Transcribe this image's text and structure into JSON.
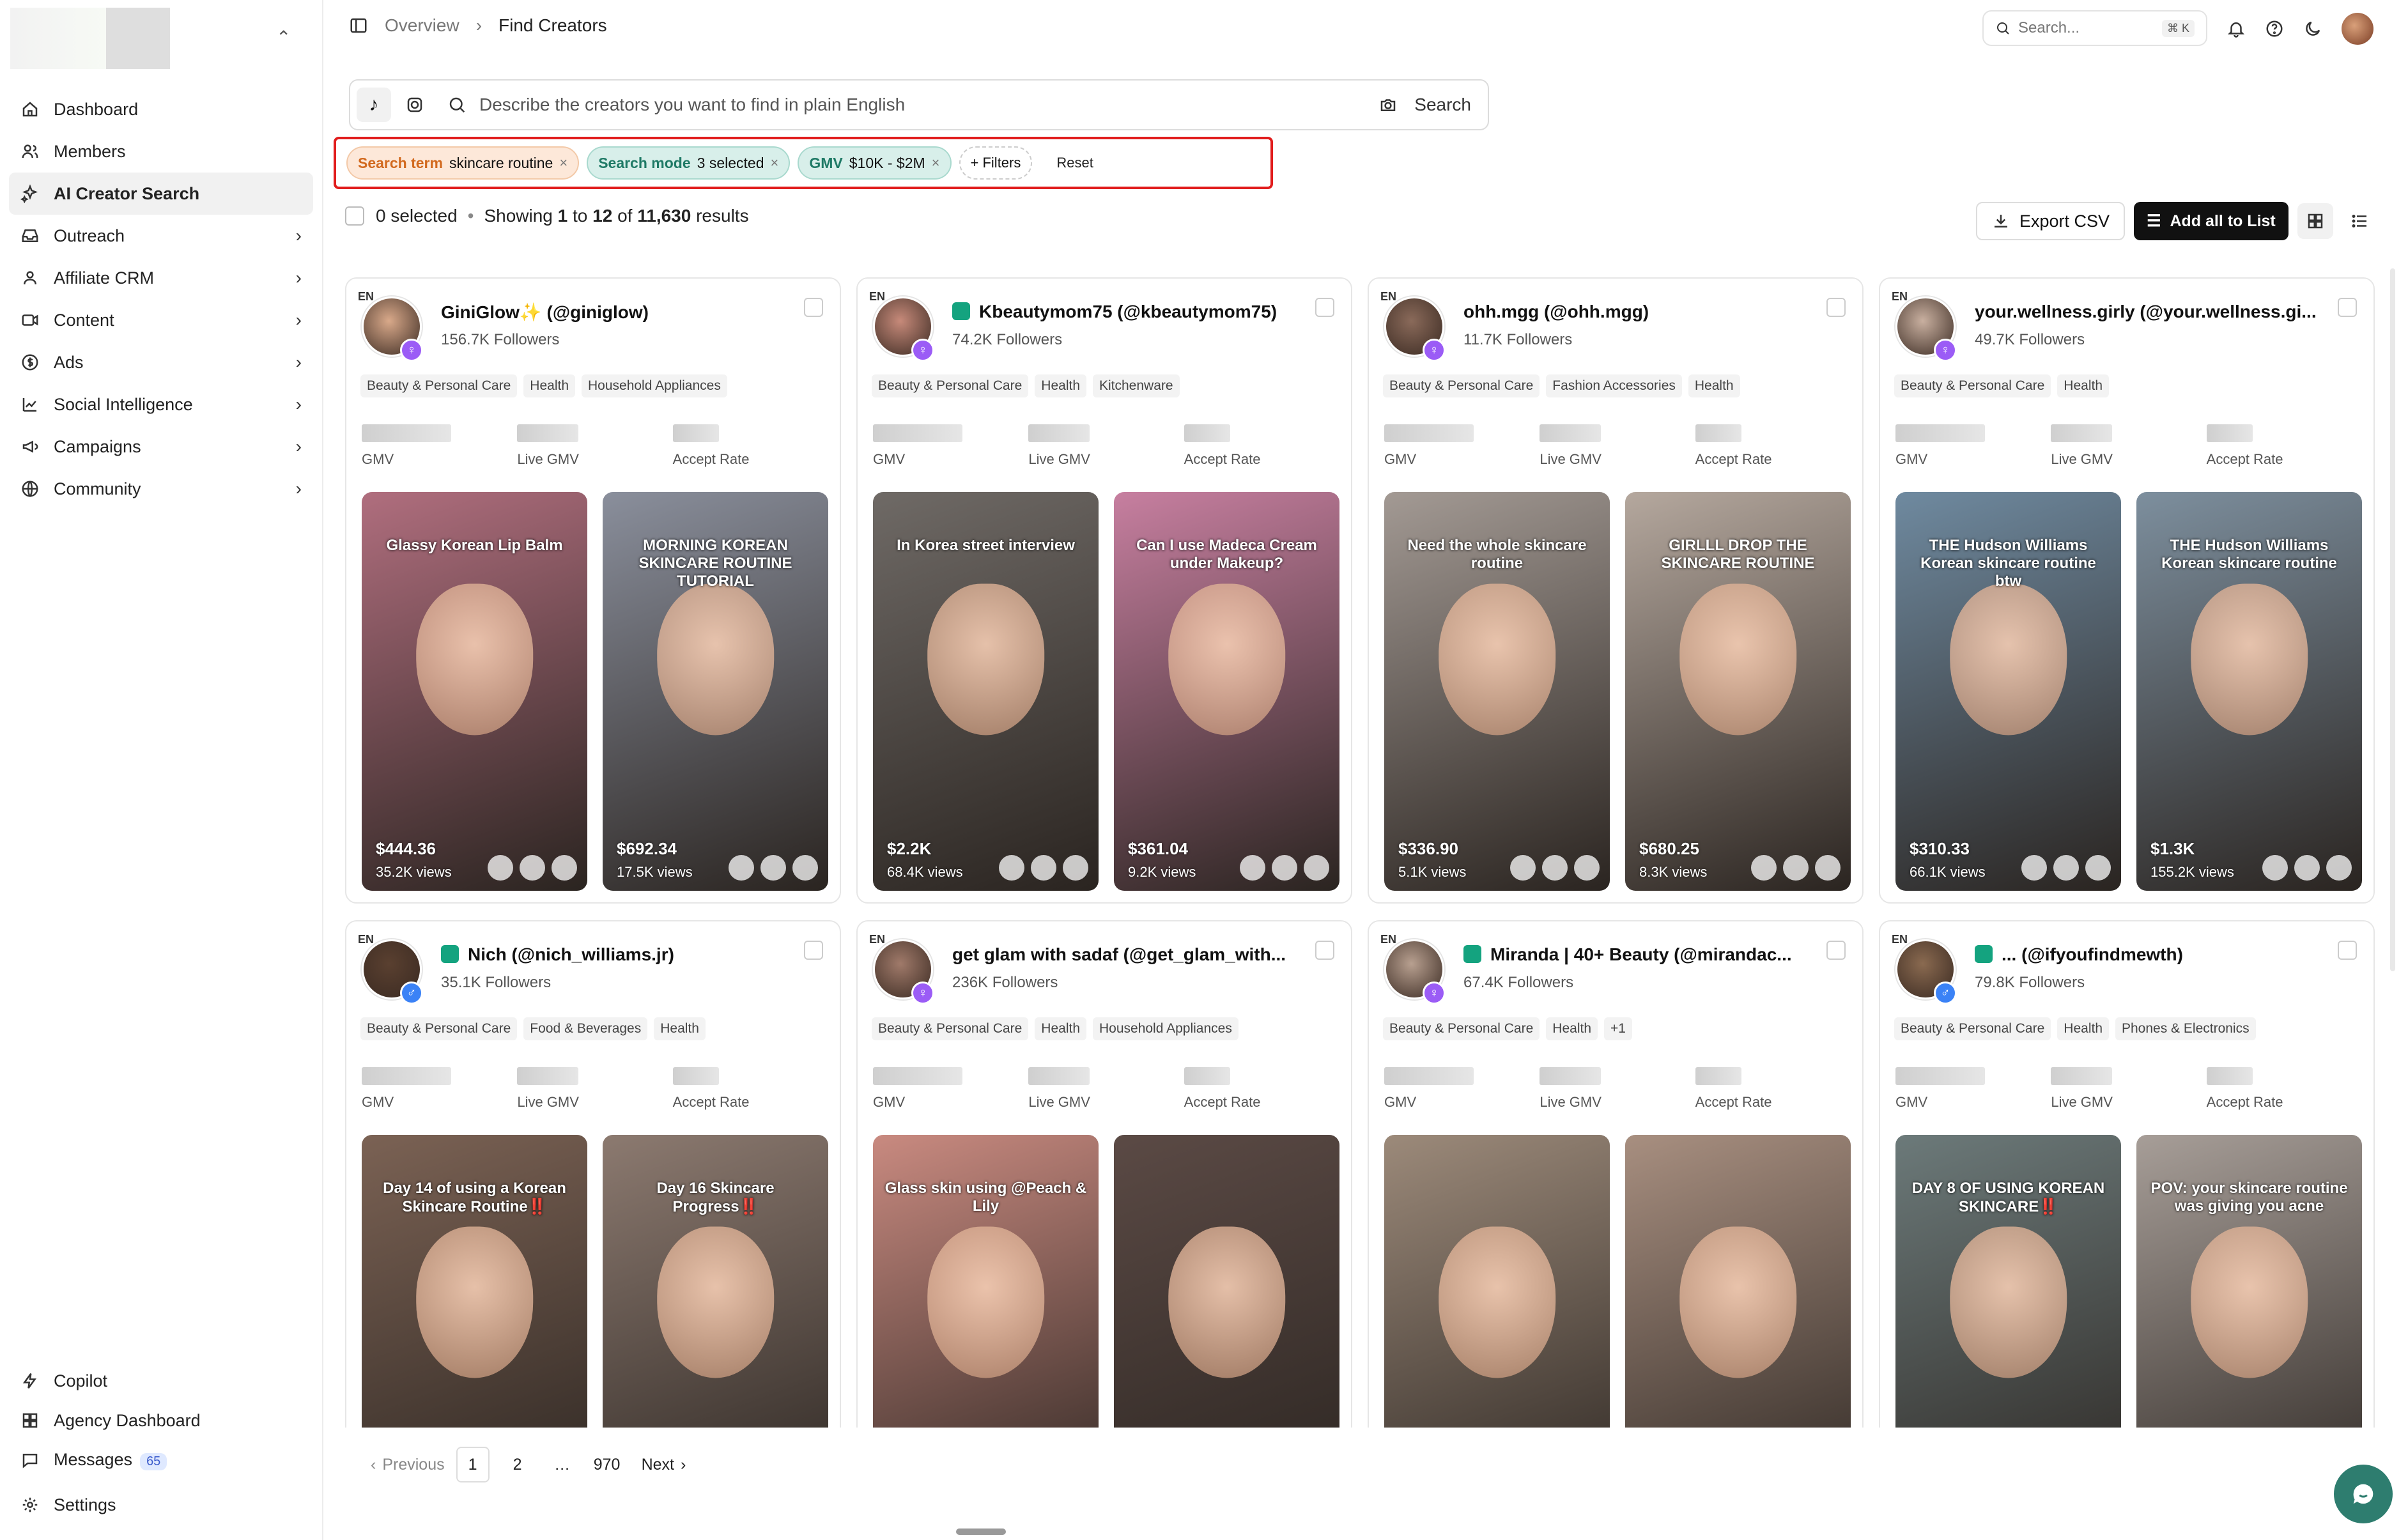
{
  "sidebar": {
    "items": [
      {
        "label": "Dashboard",
        "icon": "home-icon",
        "chevron": false,
        "active": false
      },
      {
        "label": "Members",
        "icon": "users-icon",
        "chevron": false,
        "active": false
      },
      {
        "label": "AI Creator Search",
        "icon": "sparkles-icon",
        "chevron": false,
        "active": true
      },
      {
        "label": "Outreach",
        "icon": "inbox-icon",
        "chevron": true,
        "active": false
      },
      {
        "label": "Affiliate CRM",
        "icon": "contacts-icon",
        "chevron": true,
        "active": false
      },
      {
        "label": "Content",
        "icon": "video-icon",
        "chevron": true,
        "active": false
      },
      {
        "label": "Ads",
        "icon": "dollar-icon",
        "chevron": true,
        "active": false
      },
      {
        "label": "Social Intelligence",
        "icon": "chart-icon",
        "chevron": true,
        "active": false
      },
      {
        "label": "Campaigns",
        "icon": "megaphone-icon",
        "chevron": true,
        "active": false
      },
      {
        "label": "Community",
        "icon": "globe-icon",
        "chevron": true,
        "active": false
      }
    ],
    "bottom": [
      {
        "label": "Copilot",
        "icon": "bolt-icon"
      },
      {
        "label": "Agency Dashboard",
        "icon": "grid-icon"
      },
      {
        "label": "Messages",
        "icon": "message-icon",
        "badge": "65"
      },
      {
        "label": "Settings",
        "icon": "gear-icon"
      }
    ]
  },
  "header": {
    "breadcrumb": [
      "Overview",
      "Find Creators"
    ],
    "search_placeholder": "Search...",
    "search_shortcut": "⌘ K"
  },
  "search": {
    "placeholder": "Describe the creators you want to find in plain English",
    "button": "Search"
  },
  "filters": {
    "chips": [
      {
        "key": "Search term",
        "value": "skincare routine",
        "style": "orange"
      },
      {
        "key": "Search mode",
        "value": "3 selected",
        "style": "green"
      },
      {
        "key": "GMV",
        "value": "$10K - $2M",
        "style": "green"
      }
    ],
    "add_filters": "+ Filters",
    "reset": "Reset"
  },
  "results": {
    "selected": "0 selected",
    "showing_prefix": "Showing",
    "from": "1",
    "to_word": "to",
    "to": "12",
    "of_word": "of",
    "total": "11,630",
    "suffix": "results",
    "export": "Export CSV",
    "add_all": "Add all to List"
  },
  "metric_labels": [
    "GMV",
    "Live GMV",
    "Accept Rate"
  ],
  "creators": [
    {
      "name": "GiniGlow✨ (@giniglow)",
      "followers": "156.7K Followers",
      "gender": "f",
      "cats": [
        "Beauty & Personal Care",
        "Health",
        "Household Appliances"
      ],
      "videos": [
        {
          "gmv": "$444.36",
          "views": "35.2K views",
          "caption": "Glassy Korean Lip Balm",
          "bg": "#b06e7e"
        },
        {
          "gmv": "$692.34",
          "views": "17.5K views",
          "caption": "MORNING KOREAN SKINCARE ROUTINE TUTORIAL",
          "bg": "#8a8f9c"
        }
      ]
    },
    {
      "name": "Kbeautymom75 (@kbeautymom75)",
      "followers": "74.2K Followers",
      "gender": "f",
      "tag": true,
      "cats": [
        "Beauty & Personal Care",
        "Health",
        "Kitchenware"
      ],
      "videos": [
        {
          "gmv": "$2.2K",
          "views": "68.4K views",
          "caption": "In Korea street interview",
          "bg": "#6f6a66"
        },
        {
          "gmv": "$361.04",
          "views": "9.2K views",
          "caption": "Can I use Madeca Cream under Makeup?",
          "bg": "#c77fa0"
        }
      ]
    },
    {
      "name": "ohh.mgg (@ohh.mgg)",
      "followers": "11.7K Followers",
      "gender": "f",
      "cats": [
        "Beauty & Personal Care",
        "Fashion Accessories",
        "Health"
      ],
      "videos": [
        {
          "gmv": "$336.90",
          "views": "5.1K views",
          "caption": "Need the whole skincare routine",
          "bg": "#a39a94"
        },
        {
          "gmv": "$680.25",
          "views": "8.3K views",
          "caption": "GIRLLL DROP THE SKINCARE ROUTINE",
          "bg": "#b5a89e"
        }
      ]
    },
    {
      "name": "your.wellness.girly (@your.wellness.gi...",
      "followers": "49.7K Followers",
      "gender": "f",
      "cats": [
        "Beauty & Personal Care",
        "Health"
      ],
      "videos": [
        {
          "gmv": "$310.33",
          "views": "66.1K views",
          "caption": "THE Hudson Williams Korean skincare routine btw",
          "bg": "#6f8aa0"
        },
        {
          "gmv": "$1.3K",
          "views": "155.2K views",
          "caption": "THE Hudson Williams Korean skincare routine",
          "bg": "#7d8f9e"
        }
      ]
    },
    {
      "name": "Nich (@nich_williams.jr)",
      "followers": "35.1K Followers",
      "gender": "m",
      "tag": true,
      "cats": [
        "Beauty & Personal Care",
        "Food & Beverages",
        "Health"
      ],
      "videos": [
        {
          "gmv": "",
          "views": "",
          "caption": "Day 14 of using a Korean Skincare Routine‼️",
          "bg": "#7b6254"
        },
        {
          "gmv": "",
          "views": "",
          "caption": "Day 16 Skincare Progress‼️",
          "bg": "#8c7a70"
        }
      ]
    },
    {
      "name": "get glam with sadaf (@get_glam_with...",
      "followers": "236K Followers",
      "gender": "f",
      "cats": [
        "Beauty & Personal Care",
        "Health",
        "Household Appliances"
      ],
      "videos": [
        {
          "gmv": "",
          "views": "",
          "caption": "Glass skin using @Peach & Lily",
          "bg": "#c98a80"
        },
        {
          "gmv": "",
          "views": "",
          "caption": "",
          "bg": "#5b4a45"
        }
      ]
    },
    {
      "name": "Miranda | 40+ Beauty (@mirandac...",
      "followers": "67.4K Followers",
      "gender": "f",
      "tag": true,
      "cats": [
        "Beauty & Personal Care",
        "Health",
        "+1"
      ],
      "videos": [
        {
          "gmv": "",
          "views": "",
          "caption": "",
          "bg": "#9c8a7a"
        },
        {
          "gmv": "",
          "views": "",
          "caption": "",
          "bg": "#a88f80"
        }
      ]
    },
    {
      "name": "... (@ifyoufindmewth)",
      "followers": "79.8K Followers",
      "gender": "m",
      "tag": true,
      "cats": [
        "Beauty & Personal Care",
        "Health",
        "Phones & Electronics"
      ],
      "videos": [
        {
          "gmv": "",
          "views": "",
          "caption": "DAY 8 OF USING KOREAN SKINCARE‼️",
          "bg": "#6c7a7a"
        },
        {
          "gmv": "",
          "views": "",
          "caption": "POV: your skincare routine was giving you acne",
          "bg": "#a79e98"
        }
      ]
    }
  ],
  "pagination": {
    "previous": "Previous",
    "pages": [
      "1",
      "2",
      "…",
      "970"
    ],
    "next": "Next"
  },
  "colors": {
    "accent": "#111111",
    "filter_border": "#e11d1d",
    "orange_chip": "#fde8d9",
    "green_chip": "#d8efea",
    "female_badge": "#9b5cf6",
    "male_badge": "#3b82f6",
    "chat_fab": "#2e7d6f"
  }
}
